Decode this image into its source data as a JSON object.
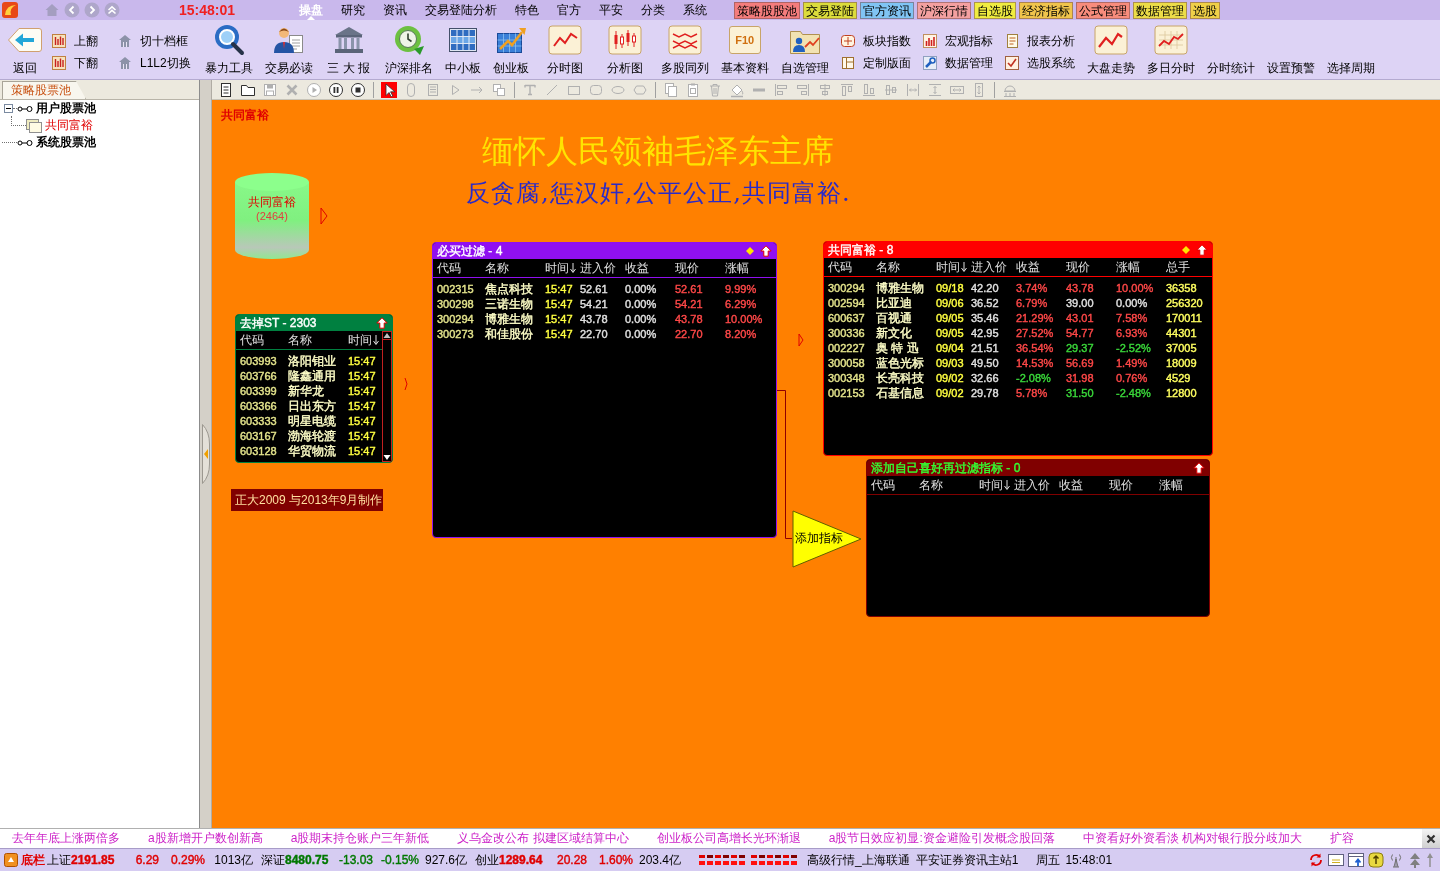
{
  "title_bar": {
    "time": "15:48:01",
    "menu": [
      {
        "label": "操盘",
        "selected": true
      },
      {
        "label": "研究",
        "selected": false
      },
      {
        "label": "资讯",
        "selected": false
      },
      {
        "label": "交易登陆分析",
        "selected": false
      },
      {
        "label": "特色",
        "selected": false
      },
      {
        "label": "官方",
        "selected": false
      },
      {
        "label": "平安",
        "selected": false
      },
      {
        "label": "分类",
        "selected": false
      },
      {
        "label": "系统",
        "selected": false
      }
    ],
    "quick_tabs": [
      {
        "label": "策略股股池",
        "color": "#f47c7c"
      },
      {
        "label": "交易登陆",
        "color": "#dcdc3c"
      },
      {
        "label": "官方资讯",
        "color": "#80c4f4"
      },
      {
        "label": "沪深行情",
        "color": "#f4a0a0"
      },
      {
        "label": "自选股",
        "color": "#f0ec40"
      },
      {
        "label": "经济指标",
        "color": "#f0c44c"
      },
      {
        "label": "公式管理",
        "color": "#f88c7c"
      },
      {
        "label": "数据管理",
        "color": "#ecdc48"
      },
      {
        "label": "选股",
        "color": "#f0d048"
      }
    ]
  },
  "toolbar": {
    "groups": [
      {
        "kind": "big",
        "label": "返回"
      },
      {
        "kind": "pair",
        "items": [
          {
            "label": "上翻"
          },
          {
            "label": "下翻"
          }
        ]
      },
      {
        "kind": "pair",
        "items": [
          {
            "label": "切十档框"
          },
          {
            "label": "L1L2切换"
          }
        ]
      },
      {
        "kind": "big",
        "label": "暴力工具"
      },
      {
        "kind": "big",
        "label": "交易必读"
      },
      {
        "kind": "big",
        "label": "三 大 报"
      },
      {
        "kind": "big",
        "label": "沪深排名"
      },
      {
        "kind": "big",
        "label": "中小板"
      },
      {
        "kind": "big",
        "label": "创业板"
      },
      {
        "kind": "big",
        "label": "分时图"
      },
      {
        "kind": "big",
        "label": "分析图"
      },
      {
        "kind": "big",
        "label": "多股同列"
      },
      {
        "kind": "big",
        "label": "基本资料",
        "badge": "F10"
      },
      {
        "kind": "big",
        "label": "自选管理"
      },
      {
        "kind": "pair",
        "items": [
          {
            "label": "板块指数"
          },
          {
            "label": "定制版面"
          }
        ]
      },
      {
        "kind": "pair",
        "items": [
          {
            "label": "宏观指标"
          },
          {
            "label": "数据管理"
          }
        ]
      },
      {
        "kind": "pair",
        "items": [
          {
            "label": "报表分析"
          },
          {
            "label": "选股系统"
          }
        ]
      },
      {
        "kind": "big",
        "label": "大盘走势"
      },
      {
        "kind": "big",
        "label": "多日分时"
      },
      {
        "kind": "text",
        "label": "分时统计"
      },
      {
        "kind": "text",
        "label": "设置预警"
      },
      {
        "kind": "text",
        "label": "选择周期"
      }
    ]
  },
  "sidebar": {
    "tab": "策略股票池",
    "tree": [
      {
        "label": "用户股票池",
        "kind": "group",
        "expanded": true,
        "children": [
          {
            "label": "共同富裕",
            "kind": "pool"
          }
        ]
      },
      {
        "label": "系统股票池",
        "kind": "group"
      }
    ]
  },
  "canvas_toolbar": {
    "tools": [
      {
        "kind": "page",
        "selected": false,
        "disabled": false
      },
      {
        "kind": "folder",
        "selected": false,
        "disabled": false
      },
      {
        "kind": "floppy",
        "selected": false,
        "disabled": true
      },
      {
        "kind": "cross",
        "selected": false,
        "disabled": true
      },
      {
        "kind": "play",
        "selected": false,
        "disabled": true
      },
      {
        "kind": "pause",
        "selected": false,
        "disabled": false
      },
      {
        "kind": "stop",
        "selected": false,
        "disabled": false
      },
      {
        "kind": "cursor",
        "selected": true,
        "disabled": false
      },
      {
        "kind": "capsule",
        "selected": false,
        "disabled": true
      },
      {
        "kind": "list",
        "selected": false,
        "disabled": true
      },
      {
        "kind": "triangle",
        "selected": false,
        "disabled": true
      },
      {
        "kind": "arrow",
        "selected": false,
        "disabled": true
      },
      {
        "kind": "overlap",
        "selected": false,
        "disabled": true
      },
      {
        "kind": "texttool",
        "selected": false,
        "disabled": true
      },
      {
        "kind": "diagonal",
        "selected": false,
        "disabled": true
      },
      {
        "kind": "rectangle",
        "selected": false,
        "disabled": true
      },
      {
        "kind": "roundrect",
        "selected": false,
        "disabled": true
      },
      {
        "kind": "ellipse",
        "selected": false,
        "disabled": true
      },
      {
        "kind": "hexagon",
        "selected": false,
        "disabled": true
      },
      {
        "kind": "pages",
        "selected": false,
        "disabled": true
      },
      {
        "kind": "clipboard",
        "selected": false,
        "disabled": true
      },
      {
        "kind": "trash",
        "selected": false,
        "disabled": true
      },
      {
        "kind": "bucket",
        "selected": false,
        "disabled": true
      },
      {
        "kind": "thickline",
        "selected": false,
        "disabled": true
      },
      {
        "kind": "alignleft",
        "selected": false,
        "disabled": true
      },
      {
        "kind": "alignright",
        "selected": false,
        "disabled": true
      },
      {
        "kind": "aligncenter",
        "selected": false,
        "disabled": true
      },
      {
        "kind": "aligntop",
        "selected": false,
        "disabled": true
      },
      {
        "kind": "alignbottom",
        "selected": false,
        "disabled": true
      },
      {
        "kind": "alignmiddle",
        "selected": false,
        "disabled": true
      },
      {
        "kind": "spreadh",
        "selected": false,
        "disabled": true
      },
      {
        "kind": "spreadv",
        "selected": false,
        "disabled": true
      },
      {
        "kind": "samewidth",
        "selected": false,
        "disabled": true
      },
      {
        "kind": "sameheight",
        "selected": false,
        "disabled": true
      },
      {
        "kind": "dome",
        "selected": false,
        "disabled": true
      }
    ]
  },
  "canvas": {
    "label": "共同富裕",
    "title": "缅怀人民领袖毛泽东主席",
    "subtitle": "反贪腐,惩汉奸,公平公正,共同富裕.",
    "pool": {
      "name": "共同富裕",
      "count": "(2464)"
    },
    "nodes": [
      {
        "title": {
          "text": "去掉ST - 2303"
        },
        "color": "#008040",
        "diamond_marker": false,
        "columns": [
          {
            "label": "代码",
            "kind": "code",
            "sorted": false
          },
          {
            "label": "名称",
            "kind": "name",
            "sorted": false
          },
          {
            "label": "时间",
            "kind": "time",
            "sorted": true
          }
        ],
        "rows": [
          [
            {
              "text": "603993"
            },
            {
              "text": "洛阳钼业"
            },
            {
              "text": "15:47"
            }
          ],
          [
            {
              "text": "603766"
            },
            {
              "text": "隆鑫通用"
            },
            {
              "text": "15:47"
            }
          ],
          [
            {
              "text": "603399"
            },
            {
              "text": "新华龙"
            },
            {
              "text": "15:47"
            }
          ],
          [
            {
              "text": "603366"
            },
            {
              "text": "日出东方"
            },
            {
              "text": "15:47"
            }
          ],
          [
            {
              "text": "603333"
            },
            {
              "text": "明星电缆"
            },
            {
              "text": "15:47"
            }
          ],
          [
            {
              "text": "603167"
            },
            {
              "text": "渤海轮渡"
            },
            {
              "text": "15:47"
            }
          ],
          [
            {
              "text": "603128"
            },
            {
              "text": "华贸物流"
            },
            {
              "text": "15:47"
            }
          ]
        ]
      },
      {
        "title": {
          "text": "必买过滤 - 4"
        },
        "color": "#9010f0",
        "diamond_marker": true,
        "columns": [
          {
            "label": "代码",
            "kind": "code",
            "sorted": false
          },
          {
            "label": "名称",
            "kind": "name",
            "sorted": false
          },
          {
            "label": "时间",
            "kind": "time",
            "sorted": true
          },
          {
            "label": "进入价",
            "kind": "entry",
            "sorted": false
          },
          {
            "label": "收益",
            "kind": "gain",
            "sorted": false
          },
          {
            "label": "现价",
            "kind": "price",
            "sorted": false
          },
          {
            "label": "涨幅",
            "kind": "change",
            "sorted": false
          }
        ],
        "rows": [
          [
            {
              "text": "002315"
            },
            {
              "text": "焦点科技"
            },
            {
              "text": "15:47"
            },
            {
              "text": "52.61"
            },
            {
              "text": "0.00%",
              "color": "#e0e0e0"
            },
            {
              "text": "52.61",
              "color": "#ff4848"
            },
            {
              "text": "9.99%",
              "color": "#ff4848"
            }
          ],
          [
            {
              "text": "300298"
            },
            {
              "text": "三诺生物"
            },
            {
              "text": "15:47"
            },
            {
              "text": "54.21"
            },
            {
              "text": "0.00%",
              "color": "#e0e0e0"
            },
            {
              "text": "54.21",
              "color": "#ff4848"
            },
            {
              "text": "6.29%",
              "color": "#ff4848"
            }
          ],
          [
            {
              "text": "300294"
            },
            {
              "text": "博雅生物"
            },
            {
              "text": "15:47"
            },
            {
              "text": "43.78"
            },
            {
              "text": "0.00%",
              "color": "#e0e0e0"
            },
            {
              "text": "43.78",
              "color": "#ff4848"
            },
            {
              "text": "10.00%",
              "color": "#ff4848"
            }
          ],
          [
            {
              "text": "300273"
            },
            {
              "text": "和佳股份"
            },
            {
              "text": "15:47"
            },
            {
              "text": "22.70"
            },
            {
              "text": "0.00%",
              "color": "#e0e0e0"
            },
            {
              "text": "22.70",
              "color": "#ff4848"
            },
            {
              "text": "8.20%",
              "color": "#ff4848"
            }
          ]
        ]
      },
      {
        "title": {
          "text": "共同富裕 - 8",
          "color": "#ffffff"
        },
        "color": "#ff0000",
        "diamond_marker": true,
        "columns": [
          {
            "label": "代码",
            "kind": "code",
            "sorted": false
          },
          {
            "label": "名称",
            "kind": "name",
            "sorted": false
          },
          {
            "label": "时间",
            "kind": "time",
            "sorted": true
          },
          {
            "label": "进入价",
            "kind": "entry",
            "sorted": false
          },
          {
            "label": "收益",
            "kind": "gain",
            "sorted": false
          },
          {
            "label": "现价",
            "kind": "price",
            "sorted": false
          },
          {
            "label": "涨幅",
            "kind": "change",
            "sorted": false
          },
          {
            "label": "总手",
            "kind": "volume",
            "sorted": false
          }
        ],
        "rows": [
          [
            {
              "text": "300294"
            },
            {
              "text": "博雅生物"
            },
            {
              "text": "09/18"
            },
            {
              "text": "42.20"
            },
            {
              "text": "3.74%",
              "color": "#ff4848"
            },
            {
              "text": "43.78",
              "color": "#ff4848"
            },
            {
              "text": "10.00%",
              "color": "#ff4848"
            },
            {
              "text": "36358"
            }
          ],
          [
            {
              "text": "002594"
            },
            {
              "text": "比亚迪"
            },
            {
              "text": "09/06"
            },
            {
              "text": "36.52"
            },
            {
              "text": "6.79%",
              "color": "#ff4848"
            },
            {
              "text": "39.00",
              "color": "#e0e0e0"
            },
            {
              "text": "0.00%",
              "color": "#e0e0e0"
            },
            {
              "text": "256320"
            }
          ],
          [
            {
              "text": "600637"
            },
            {
              "text": "百视通"
            },
            {
              "text": "09/05"
            },
            {
              "text": "35.46"
            },
            {
              "text": "21.29%",
              "color": "#ff4848"
            },
            {
              "text": "43.01",
              "color": "#ff4848"
            },
            {
              "text": "7.58%",
              "color": "#ff4848"
            },
            {
              "text": "170011"
            }
          ],
          [
            {
              "text": "300336"
            },
            {
              "text": "新文化"
            },
            {
              "text": "09/05"
            },
            {
              "text": "42.95"
            },
            {
              "text": "27.52%",
              "color": "#ff4848"
            },
            {
              "text": "54.77",
              "color": "#ff4848"
            },
            {
              "text": "6.93%",
              "color": "#ff4848"
            },
            {
              "text": "44301"
            }
          ],
          [
            {
              "text": "002227"
            },
            {
              "text": "奥 特 迅"
            },
            {
              "text": "09/04"
            },
            {
              "text": "21.51"
            },
            {
              "text": "36.54%",
              "color": "#ff4848"
            },
            {
              "text": "29.37",
              "color": "#3ad83a"
            },
            {
              "text": "-2.52%",
              "color": "#3ad83a"
            },
            {
              "text": "37005"
            }
          ],
          [
            {
              "text": "300058"
            },
            {
              "text": "蓝色光标"
            },
            {
              "text": "09/03"
            },
            {
              "text": "49.50"
            },
            {
              "text": "14.53%",
              "color": "#ff4848"
            },
            {
              "text": "56.69",
              "color": "#ff4848"
            },
            {
              "text": "1.49%",
              "color": "#ff4848"
            },
            {
              "text": "18009"
            }
          ],
          [
            {
              "text": "300348"
            },
            {
              "text": "长亮科技"
            },
            {
              "text": "09/02"
            },
            {
              "text": "32.66"
            },
            {
              "text": "-2.08%",
              "color": "#3ad83a"
            },
            {
              "text": "31.98",
              "color": "#ff4848"
            },
            {
              "text": "0.76%",
              "color": "#ff4848"
            },
            {
              "text": "4529"
            }
          ],
          [
            {
              "text": "002153"
            },
            {
              "text": "石基信息"
            },
            {
              "text": "09/02"
            },
            {
              "text": "29.78"
            },
            {
              "text": "5.78%",
              "color": "#ff4848"
            },
            {
              "text": "31.50",
              "color": "#3ad83a"
            },
            {
              "text": "-2.48%",
              "color": "#3ad83a"
            },
            {
              "text": "12800"
            }
          ]
        ]
      },
      {
        "title": {
          "text": "添加自己喜好再过滤指标 - 0",
          "color": "#33ff33"
        },
        "color": "#800000",
        "diamond_marker": false,
        "columns": [
          {
            "label": "代码",
            "kind": "code",
            "sorted": false
          },
          {
            "label": "名称",
            "kind": "name",
            "sorted": false
          },
          {
            "label": "时间",
            "kind": "time",
            "sorted": true
          },
          {
            "label": "进入价",
            "kind": "entry",
            "sorted": false
          },
          {
            "label": "收益",
            "kind": "gain",
            "sorted": false
          },
          {
            "label": "现价",
            "kind": "price",
            "sorted": false
          },
          {
            "label": "涨幅",
            "kind": "change",
            "sorted": false
          }
        ]
      }
    ],
    "credit": "正大2009 与2013年9月制作",
    "indicator": "添加指标"
  },
  "ticker": {
    "items": [
      "去年年底上涨两倍多",
      "a股新增开户数创新高",
      "a股期末持仓账户三年新低",
      "义乌金改公布 拟建区域结算中心",
      "创业板公司高增长光环渐退",
      "a股节日效应初显:资金避险引发概念股回落",
      "中资看好外资看淡 机构对银行股分歧加大",
      "扩容"
    ]
  },
  "status_bar": {
    "label": "底栏",
    "indices": [
      {
        "name": "上证",
        "value": "2191.85",
        "change": "6.29",
        "percent": "0.29%",
        "amount": "1013亿",
        "color": "#e00000"
      },
      {
        "name": "深证",
        "value": "8480.75",
        "change": "-13.03",
        "percent": "-0.15%",
        "amount": "927.6亿",
        "color": "#007800"
      },
      {
        "name": "创业",
        "value": "1289.64",
        "change": "20.28",
        "percent": "1.60%",
        "amount": "203.4亿",
        "color": "#e00000"
      }
    ],
    "server": "高级行情_上海联通",
    "info_server": "平安证券资讯主站1",
    "weekday": "周五",
    "time": "15:48:01"
  }
}
